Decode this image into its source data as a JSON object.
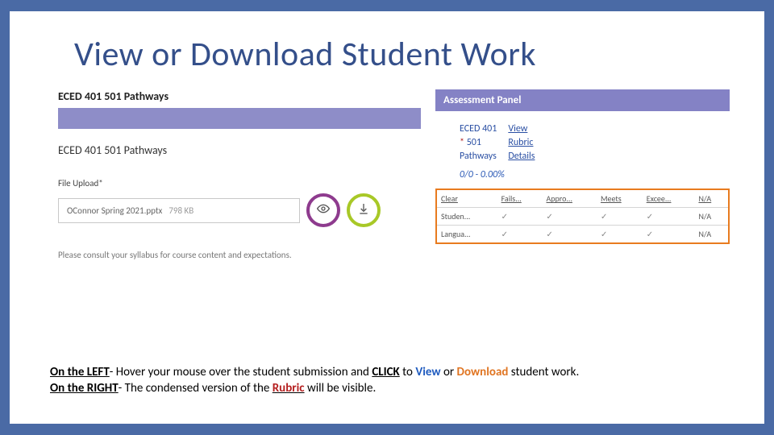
{
  "title": "View or Download Student Work",
  "left": {
    "header": "ECED 401 501 Pathways",
    "subtitle": "ECED 401 501 Pathways",
    "file_label": "File Upload*",
    "file_name": "OConnor Spring 2021.pptx",
    "file_size": "798 KB",
    "view_icon": "eye",
    "download_icon": "download",
    "footnote": "Please consult your syllabus for course content and expectations."
  },
  "right": {
    "header": "Assessment Panel",
    "course_lines": [
      "ECED 401",
      "501",
      "Pathways"
    ],
    "star_line_index": 1,
    "links": [
      "View",
      "Rubric",
      "Details"
    ],
    "score": "0/0 - 0.00%",
    "rubric_headers": [
      "Clear",
      "Fails...",
      "Appro...",
      "Meets",
      "Excee...",
      "N/A"
    ],
    "rubric_rows": [
      {
        "label": "Studen...",
        "checks": [
          true,
          true,
          true,
          true
        ],
        "na": "N/A"
      },
      {
        "label": "Langua...",
        "checks": [
          true,
          true,
          true,
          true
        ],
        "na": "N/A"
      }
    ]
  },
  "caption": {
    "left_prefix": "On the LEFT",
    "left_sentence_a": "- Hover your mouse over the student submission and ",
    "click_word": "CLICK",
    "to_word": " to ",
    "view_word": "View",
    "or_word": " or ",
    "download_word": "Download",
    "left_sentence_b": " student work.",
    "right_prefix": "On the RIGHT",
    "right_sentence_a": "- The condensed version of the ",
    "rubric_word": "Rubric",
    "right_sentence_b": " will be visible."
  }
}
